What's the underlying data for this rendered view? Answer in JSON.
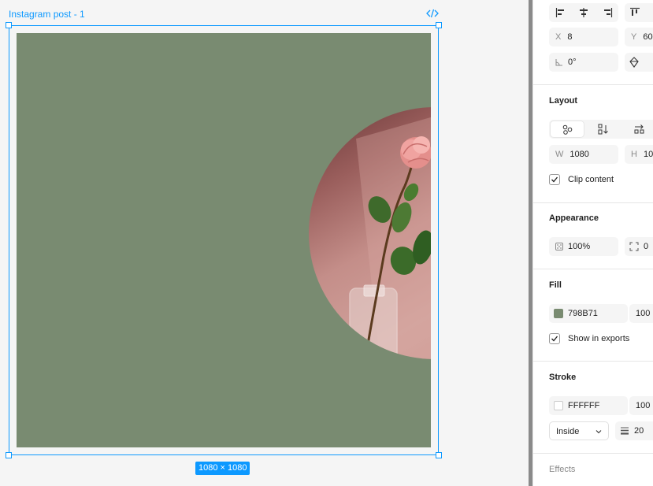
{
  "canvas": {
    "frame_name": "Instagram post - 1",
    "size_badge": "1080 × 1080",
    "fill_color": "#798B71",
    "accent": "#0d99ff"
  },
  "panel": {
    "position": {
      "x_label": "X",
      "x_value": "8",
      "y_label": "Y",
      "y_value": "60",
      "rotation": "0°"
    },
    "layout": {
      "title": "Layout",
      "w_label": "W",
      "w_value": "1080",
      "h_label": "H",
      "h_value": "10",
      "clip_label": "Clip content",
      "clip_checked": true
    },
    "appearance": {
      "title": "Appearance",
      "opacity": "100%",
      "radius": "0"
    },
    "fill": {
      "title": "Fill",
      "hex": "798B71",
      "opacity": "100",
      "color": "#798B71",
      "show_exports_label": "Show in exports"
    },
    "stroke": {
      "title": "Stroke",
      "hex": "FFFFFF",
      "opacity": "100",
      "position": "Inside",
      "weight": "20"
    },
    "effects": {
      "title": "Effects"
    }
  }
}
